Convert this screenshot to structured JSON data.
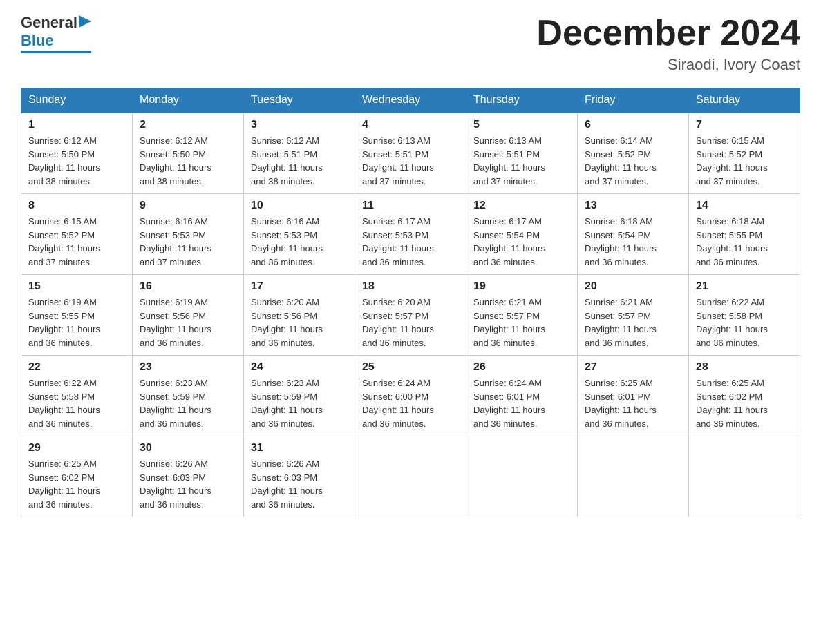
{
  "logo": {
    "general": "General",
    "blue": "Blue"
  },
  "title": "December 2024",
  "location": "Siraodi, Ivory Coast",
  "days_of_week": [
    "Sunday",
    "Monday",
    "Tuesday",
    "Wednesday",
    "Thursday",
    "Friday",
    "Saturday"
  ],
  "weeks": [
    [
      {
        "day": "1",
        "info": "Sunrise: 6:12 AM\nSunset: 5:50 PM\nDaylight: 11 hours\nand 38 minutes."
      },
      {
        "day": "2",
        "info": "Sunrise: 6:12 AM\nSunset: 5:50 PM\nDaylight: 11 hours\nand 38 minutes."
      },
      {
        "day": "3",
        "info": "Sunrise: 6:12 AM\nSunset: 5:51 PM\nDaylight: 11 hours\nand 38 minutes."
      },
      {
        "day": "4",
        "info": "Sunrise: 6:13 AM\nSunset: 5:51 PM\nDaylight: 11 hours\nand 37 minutes."
      },
      {
        "day": "5",
        "info": "Sunrise: 6:13 AM\nSunset: 5:51 PM\nDaylight: 11 hours\nand 37 minutes."
      },
      {
        "day": "6",
        "info": "Sunrise: 6:14 AM\nSunset: 5:52 PM\nDaylight: 11 hours\nand 37 minutes."
      },
      {
        "day": "7",
        "info": "Sunrise: 6:15 AM\nSunset: 5:52 PM\nDaylight: 11 hours\nand 37 minutes."
      }
    ],
    [
      {
        "day": "8",
        "info": "Sunrise: 6:15 AM\nSunset: 5:52 PM\nDaylight: 11 hours\nand 37 minutes."
      },
      {
        "day": "9",
        "info": "Sunrise: 6:16 AM\nSunset: 5:53 PM\nDaylight: 11 hours\nand 37 minutes."
      },
      {
        "day": "10",
        "info": "Sunrise: 6:16 AM\nSunset: 5:53 PM\nDaylight: 11 hours\nand 36 minutes."
      },
      {
        "day": "11",
        "info": "Sunrise: 6:17 AM\nSunset: 5:53 PM\nDaylight: 11 hours\nand 36 minutes."
      },
      {
        "day": "12",
        "info": "Sunrise: 6:17 AM\nSunset: 5:54 PM\nDaylight: 11 hours\nand 36 minutes."
      },
      {
        "day": "13",
        "info": "Sunrise: 6:18 AM\nSunset: 5:54 PM\nDaylight: 11 hours\nand 36 minutes."
      },
      {
        "day": "14",
        "info": "Sunrise: 6:18 AM\nSunset: 5:55 PM\nDaylight: 11 hours\nand 36 minutes."
      }
    ],
    [
      {
        "day": "15",
        "info": "Sunrise: 6:19 AM\nSunset: 5:55 PM\nDaylight: 11 hours\nand 36 minutes."
      },
      {
        "day": "16",
        "info": "Sunrise: 6:19 AM\nSunset: 5:56 PM\nDaylight: 11 hours\nand 36 minutes."
      },
      {
        "day": "17",
        "info": "Sunrise: 6:20 AM\nSunset: 5:56 PM\nDaylight: 11 hours\nand 36 minutes."
      },
      {
        "day": "18",
        "info": "Sunrise: 6:20 AM\nSunset: 5:57 PM\nDaylight: 11 hours\nand 36 minutes."
      },
      {
        "day": "19",
        "info": "Sunrise: 6:21 AM\nSunset: 5:57 PM\nDaylight: 11 hours\nand 36 minutes."
      },
      {
        "day": "20",
        "info": "Sunrise: 6:21 AM\nSunset: 5:57 PM\nDaylight: 11 hours\nand 36 minutes."
      },
      {
        "day": "21",
        "info": "Sunrise: 6:22 AM\nSunset: 5:58 PM\nDaylight: 11 hours\nand 36 minutes."
      }
    ],
    [
      {
        "day": "22",
        "info": "Sunrise: 6:22 AM\nSunset: 5:58 PM\nDaylight: 11 hours\nand 36 minutes."
      },
      {
        "day": "23",
        "info": "Sunrise: 6:23 AM\nSunset: 5:59 PM\nDaylight: 11 hours\nand 36 minutes."
      },
      {
        "day": "24",
        "info": "Sunrise: 6:23 AM\nSunset: 5:59 PM\nDaylight: 11 hours\nand 36 minutes."
      },
      {
        "day": "25",
        "info": "Sunrise: 6:24 AM\nSunset: 6:00 PM\nDaylight: 11 hours\nand 36 minutes."
      },
      {
        "day": "26",
        "info": "Sunrise: 6:24 AM\nSunset: 6:01 PM\nDaylight: 11 hours\nand 36 minutes."
      },
      {
        "day": "27",
        "info": "Sunrise: 6:25 AM\nSunset: 6:01 PM\nDaylight: 11 hours\nand 36 minutes."
      },
      {
        "day": "28",
        "info": "Sunrise: 6:25 AM\nSunset: 6:02 PM\nDaylight: 11 hours\nand 36 minutes."
      }
    ],
    [
      {
        "day": "29",
        "info": "Sunrise: 6:25 AM\nSunset: 6:02 PM\nDaylight: 11 hours\nand 36 minutes."
      },
      {
        "day": "30",
        "info": "Sunrise: 6:26 AM\nSunset: 6:03 PM\nDaylight: 11 hours\nand 36 minutes."
      },
      {
        "day": "31",
        "info": "Sunrise: 6:26 AM\nSunset: 6:03 PM\nDaylight: 11 hours\nand 36 minutes."
      },
      {
        "day": "",
        "info": ""
      },
      {
        "day": "",
        "info": ""
      },
      {
        "day": "",
        "info": ""
      },
      {
        "day": "",
        "info": ""
      }
    ]
  ]
}
